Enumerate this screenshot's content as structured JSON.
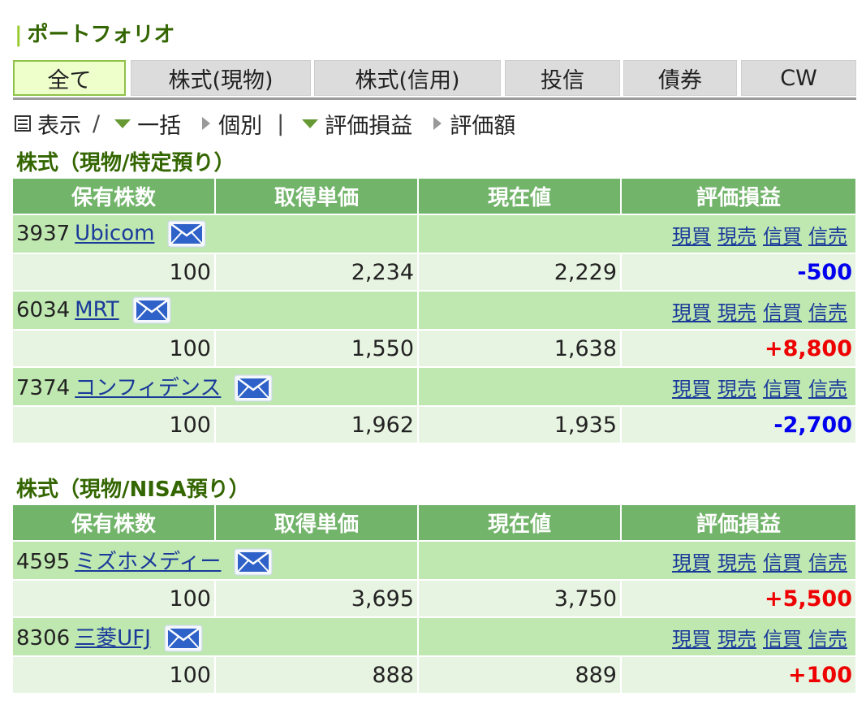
{
  "page": {
    "title": "ポートフォリオ"
  },
  "tabs": [
    {
      "label": "全て",
      "active": true
    },
    {
      "label": "株式(現物)",
      "active": false
    },
    {
      "label": "株式(信用)",
      "active": false
    },
    {
      "label": "投信",
      "active": false
    },
    {
      "label": "債券",
      "active": false
    },
    {
      "label": "CW",
      "active": false
    }
  ],
  "view": {
    "display_label": "表示",
    "slash": "/",
    "bulk_label": "一括",
    "individual_label": "個別",
    "divider": "|",
    "pl_label": "評価損益",
    "valuation_label": "評価額"
  },
  "columns": [
    "保有株数",
    "取得単価",
    "現在値",
    "評価損益"
  ],
  "actions": [
    "現買",
    "現売",
    "信買",
    "信売"
  ],
  "sections": [
    {
      "title": "株式（現物/特定預り）",
      "rows": [
        {
          "code": "3937",
          "name": "Ubicom",
          "shares": "100",
          "cost": "2,234",
          "price": "2,229",
          "pl": "-500",
          "pl_sign": "neg"
        },
        {
          "code": "6034",
          "name": "MRT",
          "shares": "100",
          "cost": "1,550",
          "price": "1,638",
          "pl": "+8,800",
          "pl_sign": "pos"
        },
        {
          "code": "7374",
          "name": "コンフィデンス",
          "shares": "100",
          "cost": "1,962",
          "price": "1,935",
          "pl": "-2,700",
          "pl_sign": "neg"
        }
      ]
    },
    {
      "title": "株式（現物/NISA預り）",
      "rows": [
        {
          "code": "4595",
          "name": "ミズホメディー",
          "shares": "100",
          "cost": "3,695",
          "price": "3,750",
          "pl": "+5,500",
          "pl_sign": "pos"
        },
        {
          "code": "8306",
          "name": "三菱UFJ",
          "shares": "100",
          "cost": "888",
          "price": "889",
          "pl": "+100",
          "pl_sign": "pos"
        }
      ]
    }
  ],
  "colors": {
    "header_green": "#73b46b",
    "name_row": "#bfe8b0",
    "value_row": "#e8f4e2",
    "loss": "#0000ee",
    "gain": "#ee0000",
    "link": "#1a3a9a"
  },
  "icons": {
    "mail": "mail-icon",
    "list": "list-icon"
  }
}
